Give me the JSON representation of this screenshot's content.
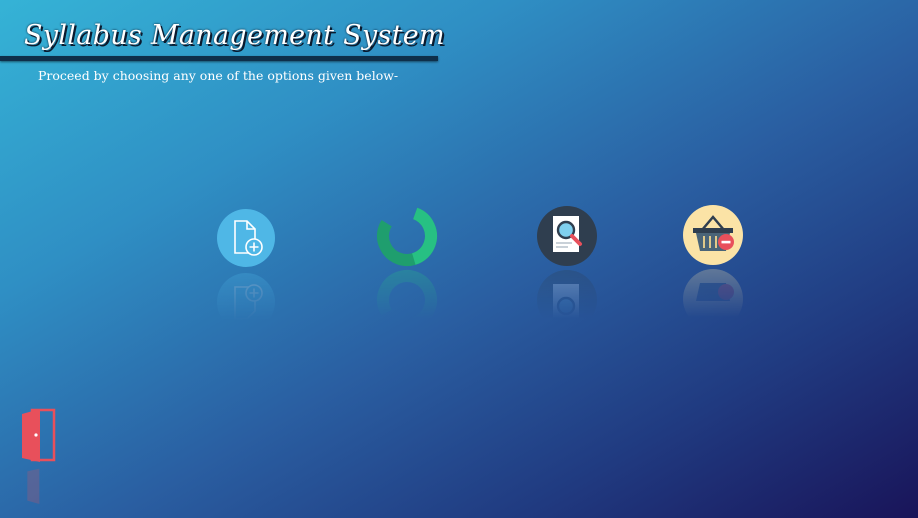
{
  "app": {
    "title": "Syllabus Management System",
    "subtitle": "Proceed by choosing any one of the options given below-"
  },
  "options": [
    {
      "icon": "add-document-icon",
      "color": "#4fb7e6"
    },
    {
      "icon": "refresh-update-icon",
      "color": "#23b07a"
    },
    {
      "icon": "search-document-icon",
      "color": "#2f3e4f"
    },
    {
      "icon": "remove-basket-icon",
      "color": "#fbe3a6"
    }
  ],
  "exit": {
    "icon": "exit-door-icon",
    "color": "#e8505b"
  }
}
